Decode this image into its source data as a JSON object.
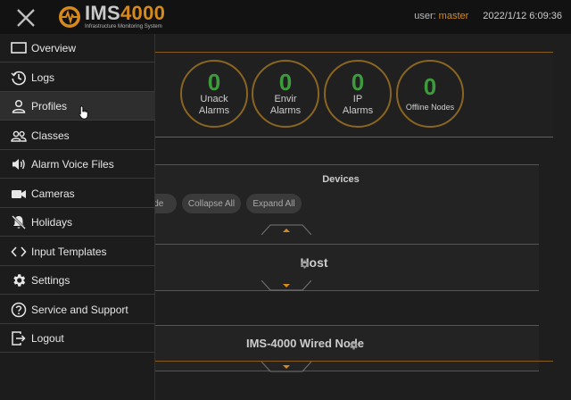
{
  "header": {
    "logo_name": "IMS",
    "logo_number": "4000",
    "logo_subtitle": "Infrastructure Monitoring System",
    "user_label": "user:",
    "user_name": "master",
    "datetime": "2022/1/12 6:09:36"
  },
  "alarms": [
    {
      "count": "0",
      "label_line1": "Unack",
      "label_line2": "Alarms"
    },
    {
      "count": "0",
      "label_line1": "Envir",
      "label_line2": "Alarms"
    },
    {
      "count": "0",
      "label_line1": "IP",
      "label_line2": "Alarms"
    },
    {
      "count": "0",
      "label_line1": "Offline Nodes",
      "label_line2": ""
    }
  ],
  "devices": {
    "title": "Devices",
    "partial_button": "ode",
    "collapse_all": "Collapse All",
    "expand_all": "Expand All"
  },
  "host": {
    "title": "Host"
  },
  "wired_node": {
    "title": "IMS-4000 Wired Node"
  },
  "menu": {
    "items": [
      {
        "label": "Overview",
        "icon": "monitor-icon"
      },
      {
        "label": "Logs",
        "icon": "history-icon"
      },
      {
        "label": "Profiles",
        "icon": "user-icon"
      },
      {
        "label": "Classes",
        "icon": "users-icon"
      },
      {
        "label": "Alarm Voice Files",
        "icon": "speaker-icon"
      },
      {
        "label": "Cameras",
        "icon": "video-camera-icon"
      },
      {
        "label": "Holidays",
        "icon": "bell-off-icon"
      },
      {
        "label": "Input Templates",
        "icon": "code-icon"
      },
      {
        "label": "Settings",
        "icon": "gear-icon"
      },
      {
        "label": "Service and Support",
        "icon": "question-icon"
      },
      {
        "label": "Logout",
        "icon": "logout-icon"
      }
    ]
  },
  "colors": {
    "accent": "#d68a1c",
    "count_green": "#3c9c3c",
    "background": "#1b1b1b"
  }
}
